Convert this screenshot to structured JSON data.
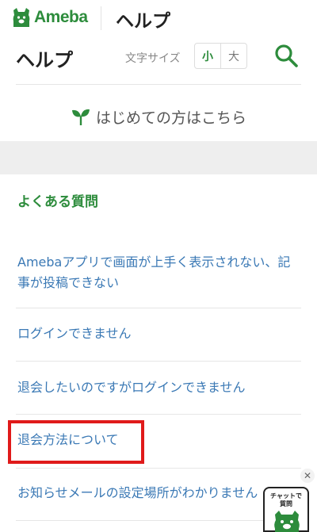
{
  "header": {
    "logo_text": "Ameba",
    "title": "ヘルプ"
  },
  "help_bar": {
    "title": "ヘルプ",
    "font_size_label": "文字サイズ",
    "font_small": "小",
    "font_large": "大",
    "search_icon": "search-icon"
  },
  "beginner_link": {
    "icon": "sprout-icon",
    "label": "はじめての方はこちら"
  },
  "faq": {
    "heading": "よくある質問",
    "items": [
      {
        "label": "Amebaアプリで画面が上手く表示されない、記事が投稿できない"
      },
      {
        "label": "ログインできません"
      },
      {
        "label": "退会したいのですがログインできません"
      },
      {
        "label": "退会方法について"
      },
      {
        "label": "お知らせメールの設定場所がわかりません"
      }
    ]
  },
  "chat_widget": {
    "line1": "チャットで",
    "line2": "質問",
    "close_icon": "close-icon"
  },
  "colors": {
    "brand_green": "#2d8c3c",
    "link_blue": "#3b79b5",
    "highlight_red": "#e01a1a"
  }
}
